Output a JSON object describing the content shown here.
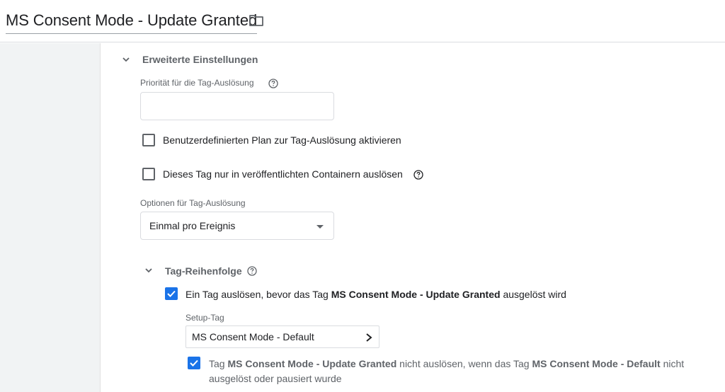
{
  "header": {
    "title": "MS Consent Mode - Update Granted",
    "folder_icon": "folder-icon"
  },
  "advanced": {
    "section_title": "Erweiterte Einstellungen",
    "priority_label": "Priorität für die Tag-Auslösung",
    "priority_value": "",
    "custom_schedule_label": "Benutzerdefinierten Plan zur Tag-Auslösung aktivieren",
    "custom_schedule_checked": false,
    "published_only_label": "Dieses Tag nur in veröffentlichten Containern auslösen",
    "published_only_checked": false,
    "firing_options_label": "Optionen für Tag-Auslösung",
    "firing_options_value": "Einmal pro Ereignis"
  },
  "sequencing": {
    "section_title": "Tag-Reihenfolge",
    "before_checked": true,
    "before_prefix": "Ein Tag auslösen, bevor das Tag",
    "before_tag": "MS Consent Mode - Update Granted",
    "before_suffix": "ausgelöst wird",
    "setup_tag_label": "Setup-Tag",
    "setup_tag_value": "MS Consent Mode - Default",
    "dont_fire_checked": true,
    "dont_fire_prefix": "Tag",
    "dont_fire_tag": "MS Consent Mode - Update Granted",
    "dont_fire_middle": "nicht auslösen, wenn das Tag",
    "dont_fire_setup": "MS Consent Mode - Default",
    "dont_fire_suffix": "nicht",
    "dont_fire_line2": "ausgelöst oder pausiert wurde"
  },
  "colors": {
    "accent": "#1a73e8",
    "left_panel": "#f1f3f4",
    "muted_text": "#5f6368"
  }
}
